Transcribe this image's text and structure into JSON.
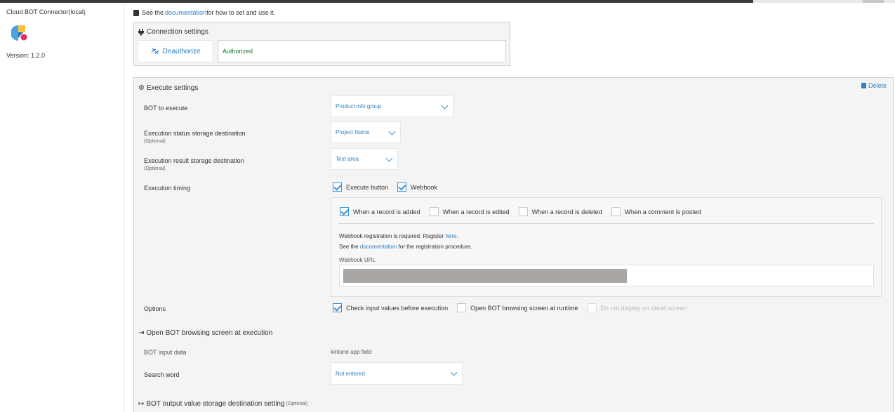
{
  "sidebar": {
    "app_name": "Cloud BOT Connector(local)",
    "version": "Version: 1.2.0"
  },
  "doc_note": {
    "prefix": "See the ",
    "link": "documentation",
    "suffix": " for how to set and use it."
  },
  "connection": {
    "title": "Connection settings",
    "deauthorize_label": "Deauthorize",
    "status": "Authorized"
  },
  "execute": {
    "title": "Execute settings",
    "delete_label": "Delete",
    "bot_to_execute": {
      "label": "BOT to execute",
      "value": "Product info group"
    },
    "status_storage": {
      "label": "Execution status storage destination",
      "optional": "(Optional)",
      "value": "Project Name"
    },
    "result_storage": {
      "label": "Execution result storage destination",
      "optional": "(Optional)",
      "value": "Text area"
    },
    "timing": {
      "label": "Execution timing",
      "options": [
        {
          "label": "Execute button",
          "checked": true
        },
        {
          "label": "Webhook",
          "checked": true
        }
      ]
    },
    "webhook": {
      "events": [
        {
          "label": "When a record is added",
          "checked": true
        },
        {
          "label": "When a record is edited",
          "checked": false
        },
        {
          "label": "When a record is deleted",
          "checked": false
        },
        {
          "label": "When a comment is posted",
          "checked": false
        }
      ],
      "register_text": "Webhook registration is required. Register ",
      "register_link": "here",
      "register_end": ".",
      "see_prefix": "See the ",
      "see_link": "documentation",
      "see_suffix": " for the registration procedure.",
      "url_label": "Webhook URL"
    },
    "options": {
      "label": "Options",
      "items": [
        {
          "label": "Check input values before execution",
          "checked": true,
          "disabled": false
        },
        {
          "label": "Open BOT browsing screen at runtime",
          "checked": false,
          "disabled": false
        },
        {
          "label": "Do not display on detail screen",
          "checked": false,
          "disabled": true
        }
      ]
    },
    "open_bot_section": {
      "title": "Open BOT browsing screen at execution",
      "input_data_label": "BOT input data",
      "input_data_value": "kintone app field",
      "search_word_label": "Search word",
      "search_word_value": "Not entered"
    },
    "output_section": {
      "title": "BOT output value storage destination setting",
      "optional": "(Optional)"
    }
  }
}
